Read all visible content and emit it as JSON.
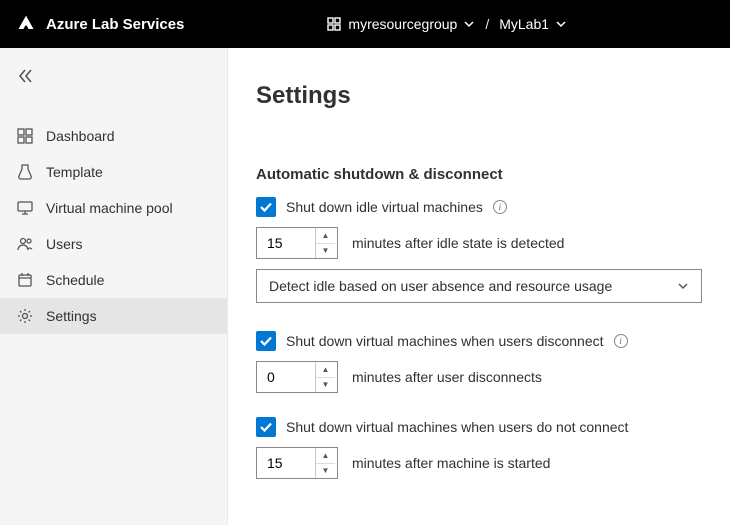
{
  "topbar": {
    "brand": "Azure Lab Services",
    "crumbs": {
      "resource_group": "myresourcegroup",
      "lab": "MyLab1"
    }
  },
  "sidebar": {
    "items": [
      {
        "label": "Dashboard"
      },
      {
        "label": "Template"
      },
      {
        "label": "Virtual machine pool"
      },
      {
        "label": "Users"
      },
      {
        "label": "Schedule"
      },
      {
        "label": "Settings"
      }
    ]
  },
  "page": {
    "title": "Settings",
    "section_title": "Automatic shutdown & disconnect",
    "idle": {
      "label": "Shut down idle virtual machines",
      "minutes": "15",
      "hint": "minutes after idle state is detected",
      "dropdown": "Detect idle based on user absence and resource usage"
    },
    "disconnect": {
      "label": "Shut down virtual machines when users disconnect",
      "minutes": "0",
      "hint": "minutes after user disconnects"
    },
    "noconnect": {
      "label": "Shut down virtual machines when users do not connect",
      "minutes": "15",
      "hint": "minutes after machine is started"
    }
  }
}
